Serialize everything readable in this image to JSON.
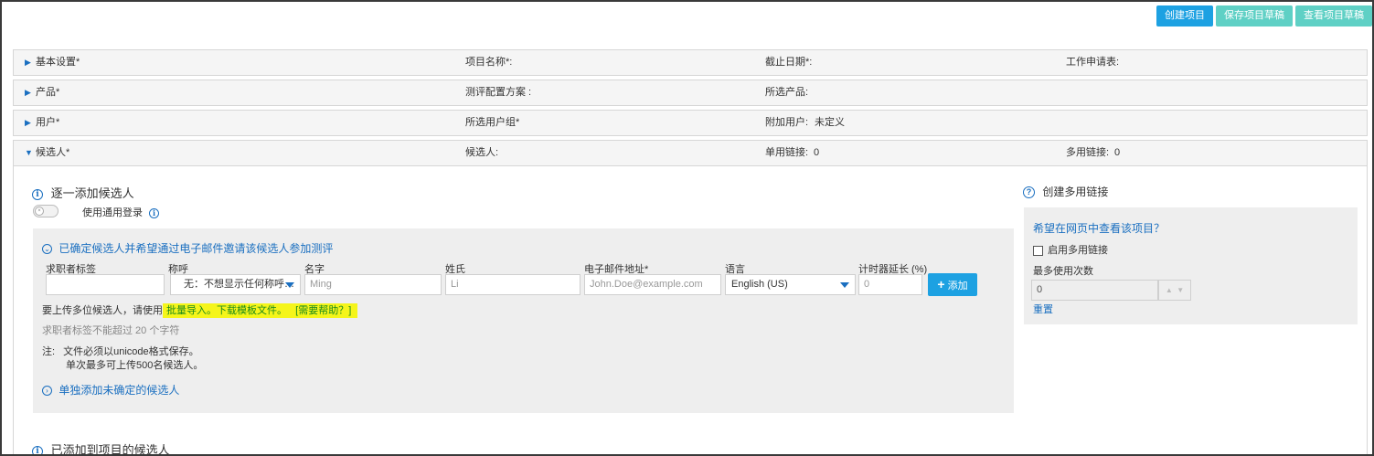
{
  "toolbar": {
    "create_label": "创建项目",
    "save_label": "保存项目草稿",
    "view_label": "查看项目草稿"
  },
  "sections": {
    "basic": {
      "title": "基本设置*",
      "col2": "项目名称*:",
      "col3": "截止日期*:",
      "col4": "工作申请表:"
    },
    "product": {
      "title": "产品*",
      "col2": "测评配置方案 :",
      "col3": "所选产品:"
    },
    "users": {
      "title": "用户*",
      "col2": "所选用户组*",
      "col3": "附加用户:",
      "col3_value": "未定义"
    },
    "candidates": {
      "title": "候选人*",
      "col2": "候选人:",
      "col3": "单用链接:",
      "col3_value": "0",
      "col4": "多用链接:",
      "col4_value": "0"
    }
  },
  "add_one": {
    "title": "逐一添加候选人",
    "common_login": "使用通用登录",
    "confirmed_title": "已确定候选人并希望通过电子邮件邀请该候选人参加测评",
    "columns": {
      "tag": "求职者标签",
      "salutation": "称呼",
      "first_name": "名字",
      "last_name": "姓氏",
      "email": "电子邮件地址*",
      "language": "语言",
      "timer": "计时器延长 (%)"
    },
    "fields": {
      "tag_value": "",
      "salutation_value": "无：不想显示任何称呼…",
      "first_name_placeholder": "Ming",
      "last_name_placeholder": "Li",
      "email_placeholder": "John.Doe@example.com",
      "language_value": "English (US)",
      "timer_placeholder": "0"
    },
    "add_button": "添加",
    "upload_prefix": "要上传多位候选人，请使用",
    "upload_link": "批量导入。下载模板文件。",
    "help_link": "[需要帮助？]",
    "tag_hint": "求职者标签不能超过 20 个字符",
    "note_label": "注:",
    "note_line1": "文件必须以unicode格式保存。",
    "note_line2": "单次最多可上传500名候选人。",
    "unconfirmed_title": "单独添加未确定的候选人"
  },
  "added": {
    "title": "已添加到项目的候选人"
  },
  "multi_link": {
    "title": "创建多用链接",
    "question": "希望在网页中查看该项目？",
    "enable_label": "启用多用链接",
    "max_uses_label": "最多使用次数",
    "max_uses_value": "0",
    "reset_label": "重置"
  },
  "colors": {
    "accent": "#1da1e2",
    "teal": "#5fd0c5",
    "link": "#1a6fc0",
    "highlight": "#f5f51a"
  },
  "icons": [
    "info-icon",
    "question-icon",
    "chevron-down-circle-icon",
    "chevron-right-circle-icon",
    "triangle-right-icon",
    "triangle-down-icon",
    "plus-icon",
    "checkbox-icon"
  ]
}
